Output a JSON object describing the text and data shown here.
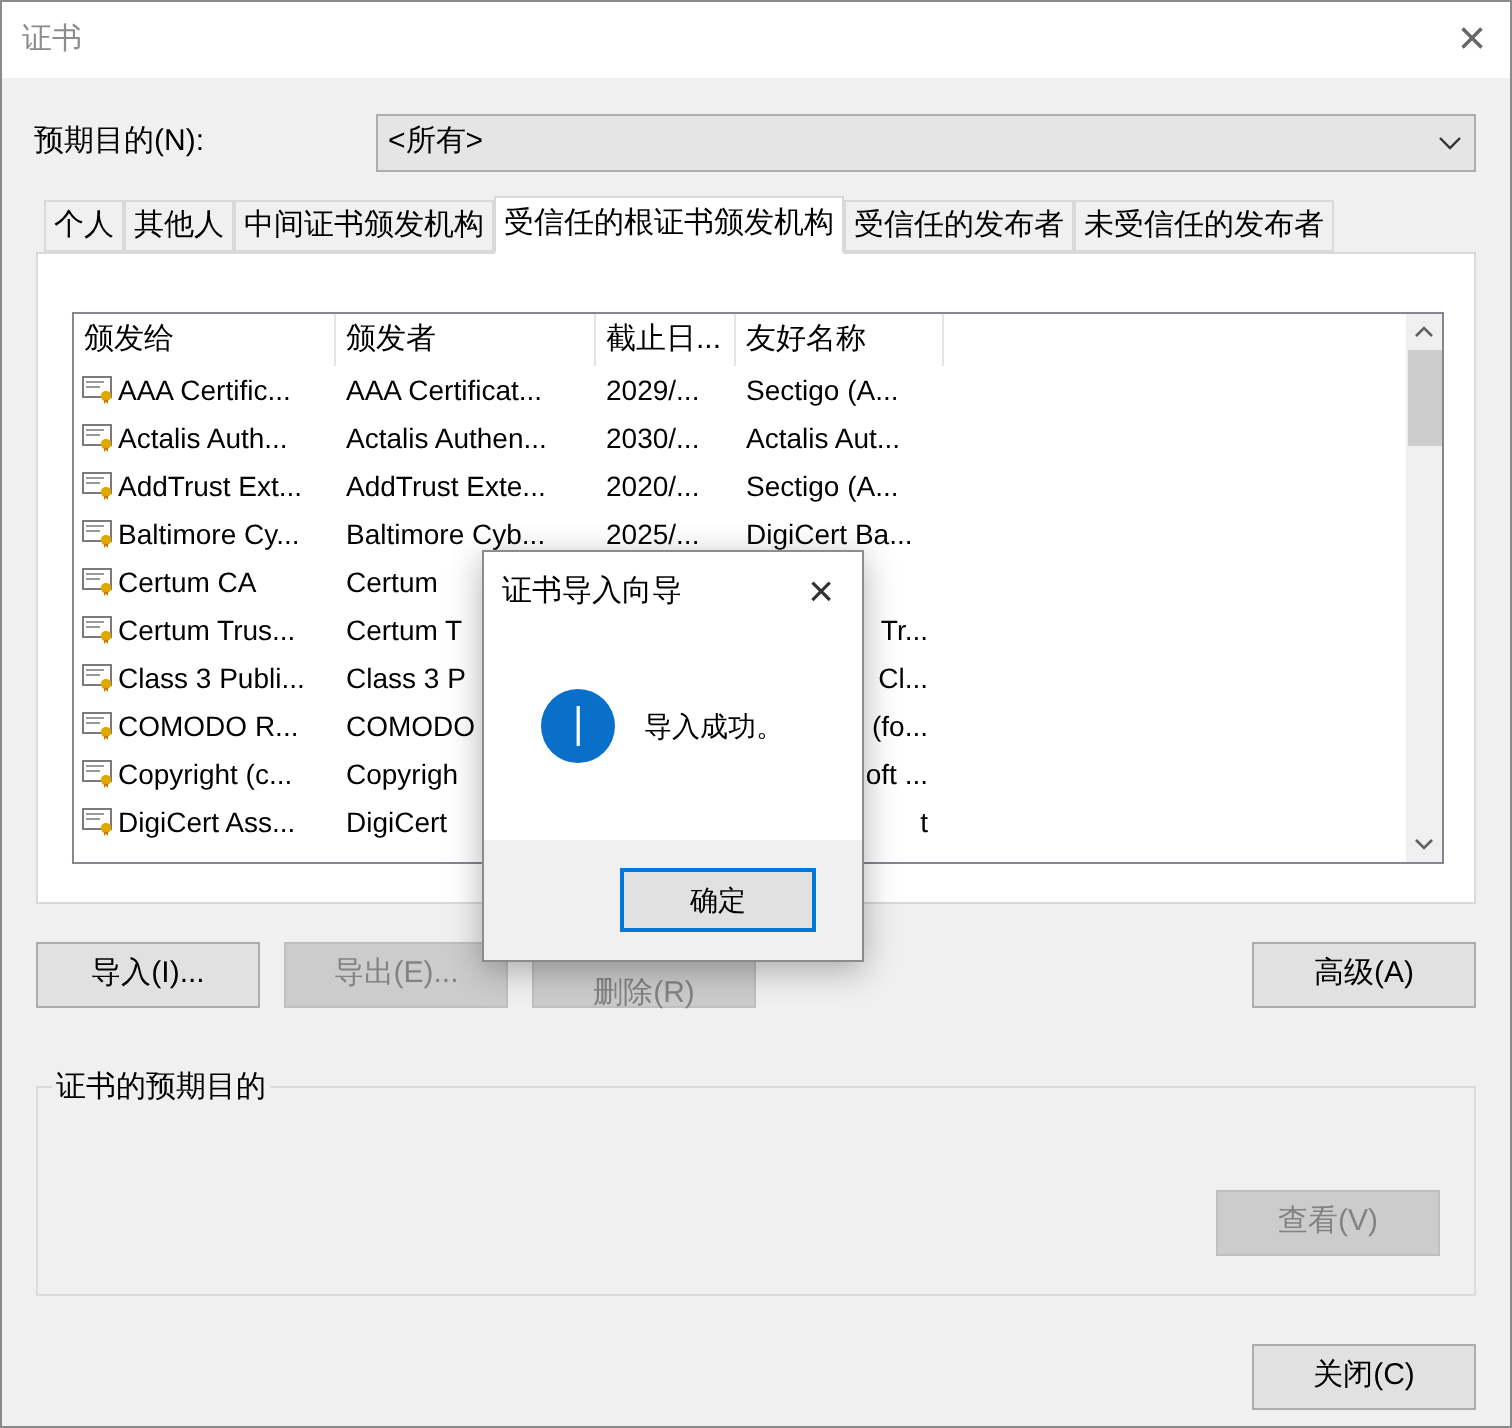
{
  "window": {
    "title": "证书",
    "close": "×"
  },
  "purpose": {
    "label": "预期目的(N):",
    "value": "<所有>"
  },
  "tabs": [
    {
      "label": "个人",
      "selected": false
    },
    {
      "label": "其他人",
      "selected": false
    },
    {
      "label": "中间证书颁发机构",
      "selected": false
    },
    {
      "label": "受信任的根证书颁发机构",
      "selected": true
    },
    {
      "label": "受信任的发布者",
      "selected": false
    },
    {
      "label": "未受信任的发布者",
      "selected": false
    }
  ],
  "table": {
    "columns": [
      "颁发给",
      "颁发者",
      "截止日...",
      "友好名称"
    ],
    "rows": [
      {
        "issued_to": "AAA Certific...",
        "issued_by": "AAA Certificat...",
        "expires": "2029/...",
        "friendly_name": "Sectigo (A..."
      },
      {
        "issued_to": "Actalis Auth...",
        "issued_by": "Actalis Authen...",
        "expires": "2030/...",
        "friendly_name": "Actalis Aut..."
      },
      {
        "issued_to": "AddTrust Ext...",
        "issued_by": "AddTrust Exte...",
        "expires": "2020/...",
        "friendly_name": "Sectigo (A..."
      },
      {
        "issued_to": "Baltimore Cy...",
        "issued_by": "Baltimore Cyb...",
        "expires": "2025/...",
        "friendly_name": "DigiCert Ba..."
      },
      {
        "issued_to": "Certum CA",
        "issued_by": "Certum"
      },
      {
        "issued_to": "Certum Trus...",
        "issued_by": "Certum T",
        "friendly_name": "Tr..."
      },
      {
        "issued_to": "Class 3 Publi...",
        "issued_by": "Class 3 P",
        "friendly_name": "Cl..."
      },
      {
        "issued_to": "COMODO R...",
        "issued_by": "COMODO",
        "friendly_name": "(fo..."
      },
      {
        "issued_to": "Copyright (c...",
        "issued_by": "Copyrigh",
        "friendly_name": "oft ..."
      },
      {
        "issued_to": "DigiCert Ass...",
        "issued_by": "DigiCert",
        "friendly_name": "t"
      }
    ]
  },
  "buttons": [
    {
      "label": "导入(I)...",
      "disabled": false
    },
    {
      "label": "导出(E)...",
      "disabled": true
    },
    {
      "label": "删除(R)",
      "disabled": true
    }
  ],
  "advanced_button": {
    "label": "高级(A)",
    "disabled": false
  },
  "purpose_group": {
    "title": "证书的预期目的",
    "view_button": {
      "label": "查看(V)",
      "disabled": true
    }
  },
  "close_button": {
    "label": "关闭(C)",
    "disabled": false
  },
  "dialog": {
    "title": "证书导入向导",
    "close": "×",
    "message": "导入成功。",
    "ok": "确定"
  }
}
